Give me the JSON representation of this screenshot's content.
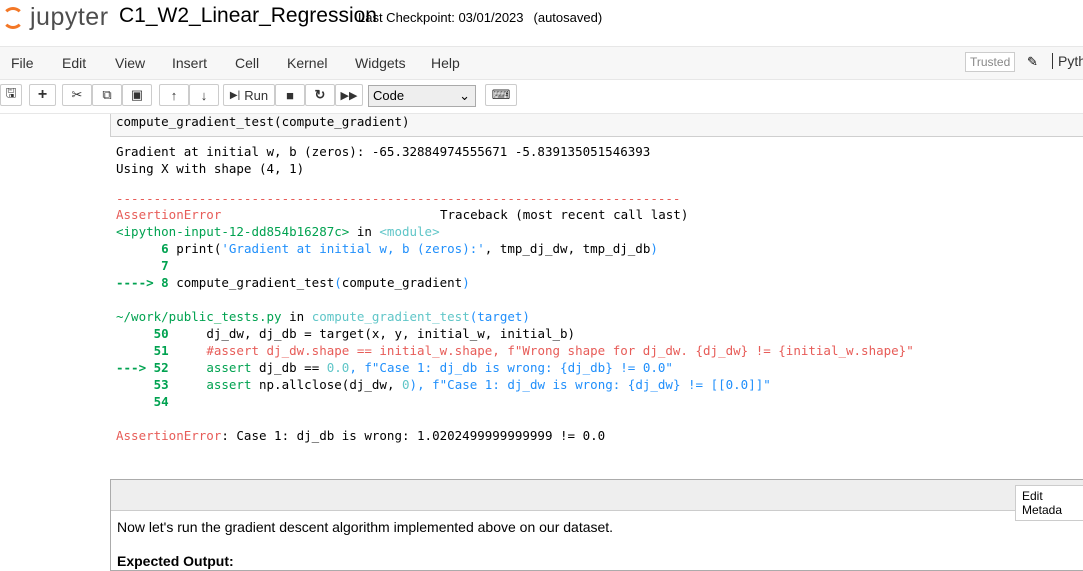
{
  "header": {
    "logo_text": "jupyter",
    "notebook_name": "C1_W2_Linear_Regression",
    "checkpoint": "Last Checkpoint: 03/01/2023",
    "autosave": "(autosaved)"
  },
  "menu": {
    "items": [
      "File",
      "Edit",
      "View",
      "Insert",
      "Cell",
      "Kernel",
      "Widgets",
      "Help"
    ],
    "trusted": "Trusted",
    "kernel": "Pyth"
  },
  "toolbar": {
    "run_label": "Run",
    "cell_type": "Code"
  },
  "cell": {
    "input": "compute_gradient_test(compute_gradient)",
    "out1": "Gradient at initial w, b (zeros): -65.32884974555671 -5.839135051546393",
    "out2": "Using X with shape (4, 1)",
    "dashes": "---------------------------------------------------------------------------",
    "err_name": "AssertionError",
    "traceback": "Traceback (most recent call last)",
    "input_ref": "<ipython-input-12-dd854b16287c>",
    "in_kw": " in ",
    "module": "<module>",
    "l6_no": "      6 ",
    "l6_a": "print(",
    "l6_s": "'Gradient at initial w, b (zeros):'",
    "l6_b": ", tmp_dj_dw, tmp_dj_db",
    ")": ")",
    "l7": "      7",
    "l8_arrow": "----> 8 ",
    "l8_code": "compute_gradient_test",
    "l8_p1": "(",
    "l8_arg": "compute_gradient",
    "l8_p2": ")",
    "file": "~/work/public_tests.py",
    "func": "compute_gradient_test",
    "func_arg": "(target)",
    "l50_no": "     50 ",
    "l50": "    dj_dw, dj_db = target(x, y, initial_w, initial_b)",
    "l51_no": "     51 ",
    "l51": "    #assert dj_dw.shape == initial_w.shape, f\"Wrong shape for dj_dw. {dj_dw} != {initial_w.shape}\"",
    "l52_no": "---> 52 ",
    "l52_kw": "    assert",
    "l52_a": " dj_db ==",
    "l52_n": " 0.0",
    "l52_s": ", f\"Case 1: dj_db is wrong: {dj_db} != 0.0\"",
    "l53_no": "     53 ",
    "l53_kw": "    assert",
    "l53_a": " np.allclose(dj_dw,",
    "l53_n": " 0",
    "l53_s": "), f\"Case 1: dj_dw is wrong: {dj_dw} != [[0.0]]\"",
    "l54_no": "     54",
    "final_msg": ": Case 1: dj_db is wrong: 1.0202499999999999 != 0.0"
  },
  "markdown": {
    "edit_metadata": "Edit Metada",
    "text": "Now let's run the gradient descent algorithm implemented above on our dataset.",
    "heading": "Expected Output:"
  }
}
